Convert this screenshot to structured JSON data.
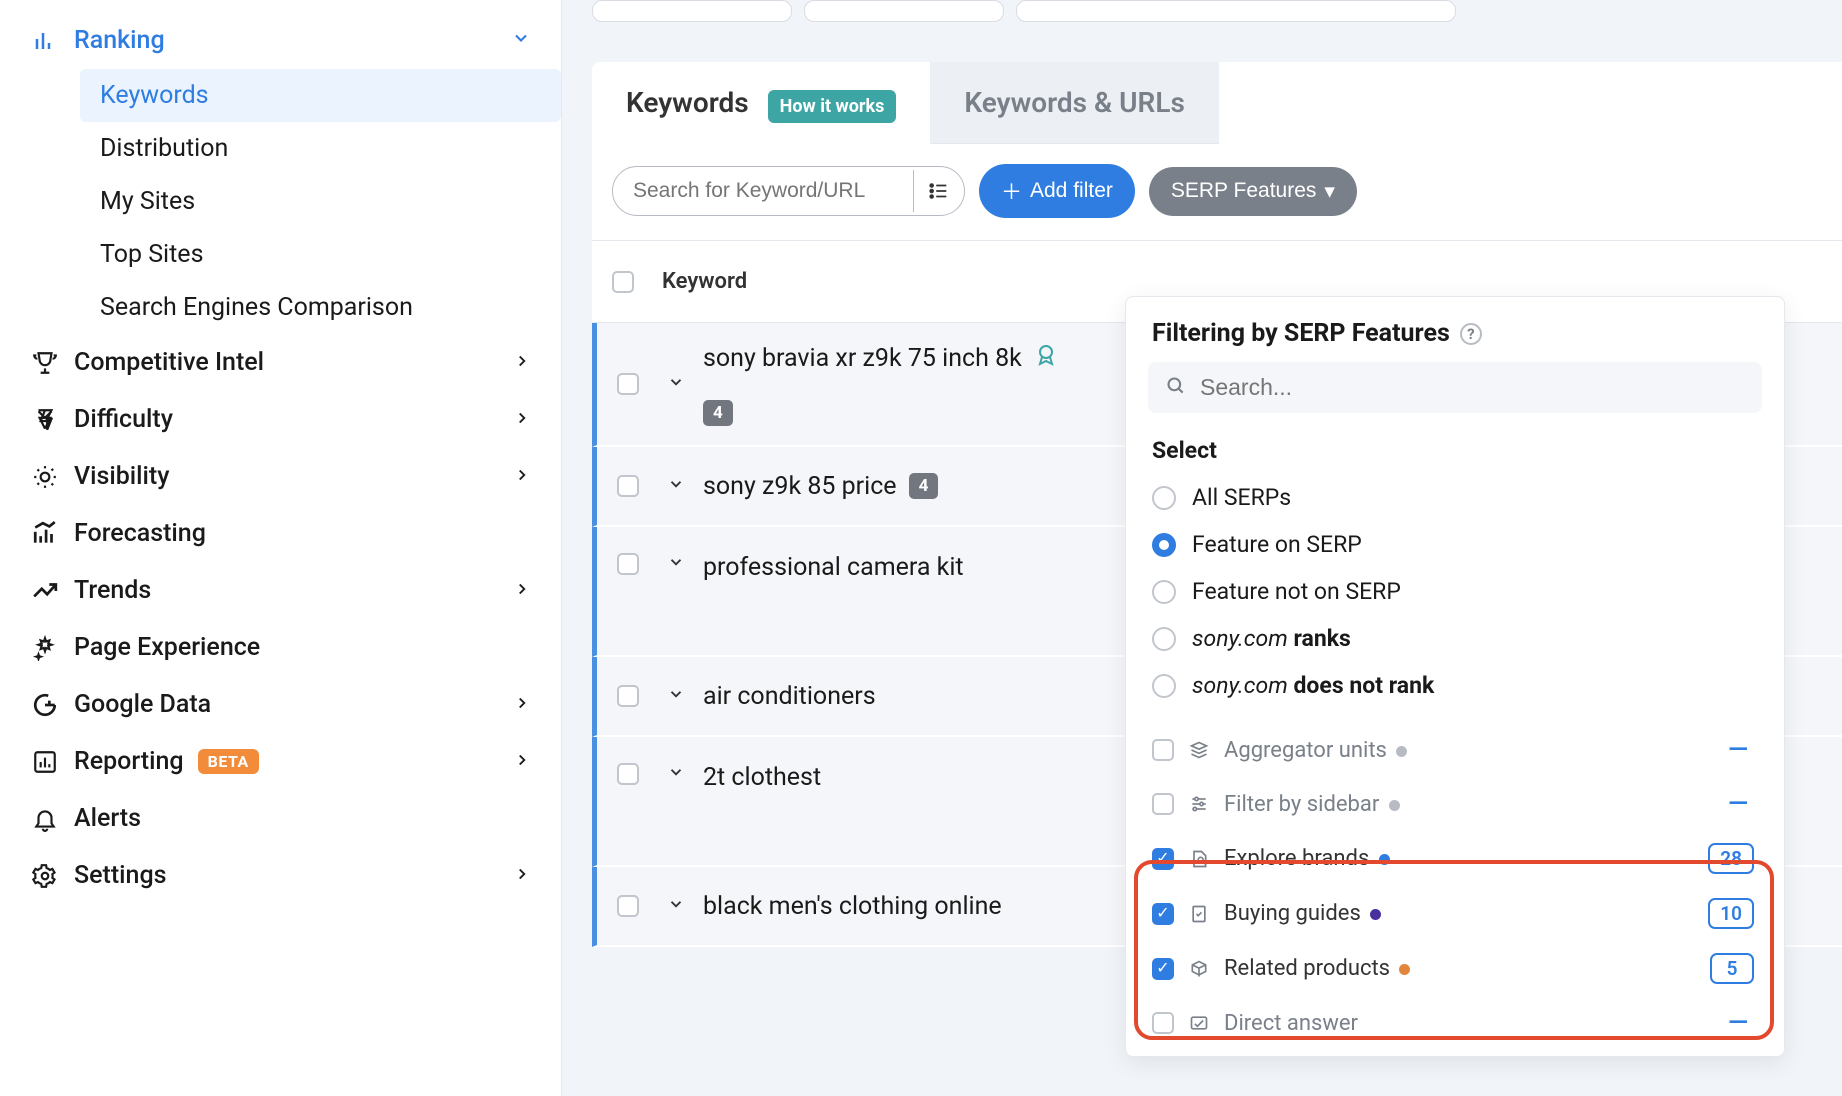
{
  "sidebar": {
    "ranking": {
      "label": "Ranking",
      "items": [
        {
          "label": "Keywords",
          "selected": true
        },
        {
          "label": "Distribution"
        },
        {
          "label": "My Sites"
        },
        {
          "label": "Top Sites"
        },
        {
          "label": "Search Engines Comparison"
        }
      ]
    },
    "items": [
      {
        "label": "Competitive Intel"
      },
      {
        "label": "Difficulty"
      },
      {
        "label": "Visibility"
      },
      {
        "label": "Forecasting",
        "no_chevron": true
      },
      {
        "label": "Trends"
      },
      {
        "label": "Page Experience",
        "no_chevron": true
      },
      {
        "label": "Google Data"
      },
      {
        "label": "Reporting",
        "beta": "BETA"
      },
      {
        "label": "Alerts",
        "no_chevron": true
      },
      {
        "label": "Settings"
      }
    ]
  },
  "tabs": {
    "keywords": "Keywords",
    "how_it_works": "How it works",
    "keywords_urls": "Keywords & URLs"
  },
  "toolbar": {
    "search_placeholder": "Search for Keyword/URL",
    "add_filter": "Add filter",
    "serp_features": "SERP Features"
  },
  "table": {
    "header_keyword": "Keyword",
    "rows": [
      {
        "text": "sony bravia xr z9k 75 inch 8k",
        "badge": "4",
        "ribbon": true,
        "badge_below": true
      },
      {
        "text": "sony z9k 85 price",
        "badge": "4"
      },
      {
        "text": "professional camera kit",
        "tall": true
      },
      {
        "text": "air conditioners"
      },
      {
        "text": "2t clothest",
        "tall": true
      },
      {
        "text": "black men's clothing online"
      }
    ]
  },
  "dropdown": {
    "title": "Filtering by SERP Features",
    "search_placeholder": "Search...",
    "select_label": "Select",
    "radios": [
      {
        "label": "All SERPs"
      },
      {
        "label": "Feature on SERP",
        "on": true
      },
      {
        "label": "Feature not on SERP"
      },
      {
        "prefix_ital": "sony.com",
        "suffix": " ranks"
      },
      {
        "prefix_ital": "sony.com",
        "suffix": " does not rank"
      }
    ],
    "features": [
      {
        "label": "Aggregator units",
        "dot": "#b7bcc4",
        "muted": true,
        "dash": true
      },
      {
        "label": "Filter by sidebar",
        "dot": "#b7bcc4",
        "muted": true,
        "dash": true
      },
      {
        "label": "Explore brands",
        "dot": "#2f7de1",
        "checked": true,
        "count": "28"
      },
      {
        "label": "Buying guides",
        "dot": "#4a2f9e",
        "checked": true,
        "count": "10"
      },
      {
        "label": "Related products",
        "dot": "#e2863b",
        "checked": true,
        "count": "5"
      },
      {
        "label": "Direct answer",
        "muted": true,
        "dash": true
      }
    ]
  },
  "colors": {
    "accent": "#2f7de1"
  }
}
